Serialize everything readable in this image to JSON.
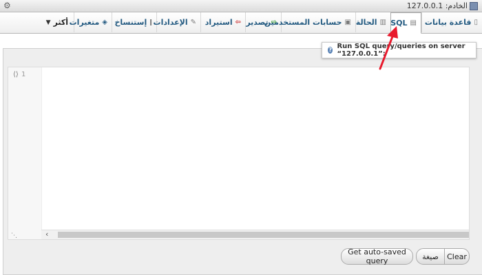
{
  "topbar": {
    "server_label": "الخادم: 127.0.0.1"
  },
  "tabs": [
    {
      "label": "قاعدة بيانات",
      "icon": "database-icon"
    },
    {
      "label": "SQL",
      "icon": "sql-icon",
      "active": true
    },
    {
      "label": "الحالة",
      "icon": "status-icon"
    },
    {
      "label": "حسابات المستخدمين",
      "icon": "users-icon"
    },
    {
      "label": "تصدير",
      "icon": "export-icon"
    },
    {
      "label": "استيراد",
      "icon": "import-icon"
    },
    {
      "label": "الإعدادات",
      "icon": "settings-icon"
    },
    {
      "label": "إستنساخ",
      "icon": "replication-icon"
    },
    {
      "label": "متغيرات",
      "icon": "variables-icon"
    },
    {
      "label": "أكثر",
      "icon": "caret-down-icon"
    }
  ],
  "tooltip": {
    "text": "Run SQL query/queries on server “127.0.0.1”:"
  },
  "editor": {
    "line_number": "1"
  },
  "buttons": {
    "clear": "Clear",
    "format": "صيغة",
    "auto_saved": "Get auto-saved query"
  },
  "colors": {
    "tab_text": "#235a81",
    "arrow": "#e8192c",
    "panel_bg": "#eeeeee"
  }
}
